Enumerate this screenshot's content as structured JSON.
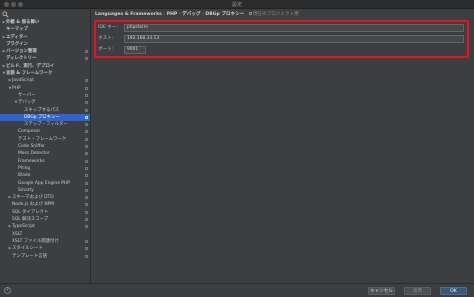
{
  "window": {
    "title": "設定"
  },
  "search": {
    "icon": "search-icon"
  },
  "sidebar": {
    "items": [
      {
        "label": "外観 & 振る舞い",
        "arrow": "▶",
        "indent": 0,
        "bold": true
      },
      {
        "label": "キーマップ",
        "arrow": "",
        "indent": 0,
        "bold": true
      },
      {
        "label": "エディター",
        "arrow": "▶",
        "indent": 0,
        "bold": true
      },
      {
        "label": "プラグイン",
        "arrow": "",
        "indent": 0,
        "bold": true
      },
      {
        "label": "バージョン管理",
        "arrow": "▶",
        "indent": 0,
        "bold": true,
        "project": true
      },
      {
        "label": "ディレクトリー",
        "arrow": "",
        "indent": 0,
        "bold": true,
        "project": true
      },
      {
        "label": "ビルド、実行、デプロイ",
        "arrow": "▶",
        "indent": 0,
        "bold": true
      },
      {
        "label": "言語 & フレームワーク",
        "arrow": "▼",
        "indent": 0,
        "bold": true
      },
      {
        "label": "JavaScript",
        "arrow": "▶",
        "indent": 1,
        "project": true
      },
      {
        "label": "PHP",
        "arrow": "▼",
        "indent": 1,
        "project": true
      },
      {
        "label": "サーバー",
        "arrow": "",
        "indent": 2,
        "project": true
      },
      {
        "label": "デバッグ",
        "arrow": "▼",
        "indent": 2,
        "project": true
      },
      {
        "label": "スキップするパス",
        "arrow": "",
        "indent": 3,
        "project": true
      },
      {
        "label": "DBGp プロキシー",
        "arrow": "",
        "indent": 3,
        "project": true,
        "selected": true
      },
      {
        "label": "ステップ・フィルター",
        "arrow": "",
        "indent": 3,
        "project": true
      },
      {
        "label": "Composer",
        "arrow": "",
        "indent": 2,
        "project": true
      },
      {
        "label": "テスト・フレームワーク",
        "arrow": "",
        "indent": 2,
        "project": true
      },
      {
        "label": "Code Sniffer",
        "arrow": "",
        "indent": 2,
        "project": true
      },
      {
        "label": "Mess Detector",
        "arrow": "",
        "indent": 2,
        "project": true
      },
      {
        "label": "Frameworks",
        "arrow": "",
        "indent": 2,
        "project": true
      },
      {
        "label": "Phing",
        "arrow": "",
        "indent": 2,
        "project": true
      },
      {
        "label": "Blade",
        "arrow": "",
        "indent": 2,
        "project": true
      },
      {
        "label": "Google App Engine PHP",
        "arrow": "",
        "indent": 2,
        "project": true
      },
      {
        "label": "Smarty",
        "arrow": "",
        "indent": 2,
        "project": true
      },
      {
        "label": "スキーマおよび DTD",
        "arrow": "▶",
        "indent": 1,
        "project": true
      },
      {
        "label": "Node.js および NPM",
        "arrow": "",
        "indent": 1,
        "project": true
      },
      {
        "label": "SQL ダイアレクト",
        "arrow": "",
        "indent": 1,
        "project": true
      },
      {
        "label": "SQL 解決スコープ",
        "arrow": "",
        "indent": 1,
        "project": true
      },
      {
        "label": "TypeScript",
        "arrow": "▶",
        "indent": 1,
        "project": true
      },
      {
        "label": "XSLT",
        "arrow": "",
        "indent": 1
      },
      {
        "label": "XSLT ファイル関連付け",
        "arrow": "",
        "indent": 1,
        "project": true
      },
      {
        "label": "スタイルシート",
        "arrow": "▶",
        "indent": 1,
        "project": true
      },
      {
        "label": "テンプレート言語",
        "arrow": "",
        "indent": 1,
        "project": true
      }
    ]
  },
  "breadcrumb": {
    "parts": [
      "Languages & Frameworks",
      "PHP",
      "デバッグ",
      "DBGp プロキシー"
    ],
    "separator": "›",
    "project_note": "現在のプロジェクト用"
  },
  "form": {
    "ide_key": {
      "label": "IDE キー:",
      "value": "phpstorm"
    },
    "host": {
      "label": "ホスト:",
      "value": "192.168.33.13"
    },
    "port": {
      "label": "ポート:",
      "value": "9001"
    }
  },
  "footer": {
    "help": "?",
    "cancel": "キャンセル",
    "apply": "適用",
    "ok": "OK"
  },
  "colors": {
    "background": "#3c3f41",
    "selection": "#2f65ca",
    "highlight_border": "#e8141c",
    "ok_button": "#365880"
  }
}
